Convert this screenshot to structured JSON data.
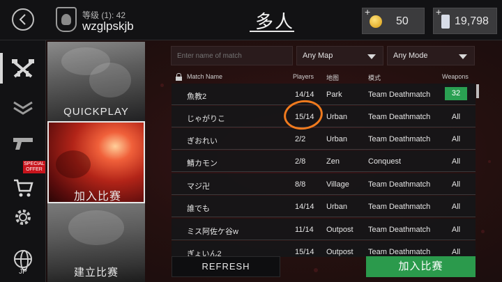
{
  "header": {
    "level_text": "等级 (1): 42",
    "username": "wzglpskjb",
    "title": "多人",
    "gold_value": "50",
    "cash_value": "19,798",
    "plus": "+"
  },
  "sidebar": {
    "special_offer": "SPECIAL OFFER",
    "language": "JP",
    "items": [
      "multiplayer-icon",
      "ranks-icon",
      "weapons-icon",
      "shop-icon",
      "settings-icon",
      "globe-icon"
    ]
  },
  "modes": {
    "quickplay": "QUICKPLAY",
    "join": "加入比赛",
    "create": "建立比赛"
  },
  "filters": {
    "search_placeholder": "Enter name of match",
    "map_value": "Any Map",
    "mode_value": "Any Mode"
  },
  "table": {
    "headers": {
      "name": "Match Name",
      "players": "Players",
      "map": "地图",
      "mode": "模式",
      "weapons": "Weapons"
    },
    "rows": [
      {
        "name": "魚教2",
        "players": "14/14",
        "map": "Park",
        "mode": "Team Deathmatch",
        "weapons": "32"
      },
      {
        "name": "じゃがりこ",
        "players": "15/14",
        "map": "Urban",
        "mode": "Team Deathmatch",
        "weapons": "All"
      },
      {
        "name": "ぎおれい",
        "players": "2/2",
        "map": "Urban",
        "mode": "Team Deathmatch",
        "weapons": "All"
      },
      {
        "name": "鯖カモン",
        "players": "2/8",
        "map": "Zen",
        "mode": "Conquest",
        "weapons": "All"
      },
      {
        "name": "マジ卍",
        "players": "8/8",
        "map": "Village",
        "mode": "Team Deathmatch",
        "weapons": "All"
      },
      {
        "name": "誰でも",
        "players": "14/14",
        "map": "Urban",
        "mode": "Team Deathmatch",
        "weapons": "All"
      },
      {
        "name": "ミス阿佐ケ谷w",
        "players": "11/14",
        "map": "Outpost",
        "mode": "Team Deathmatch",
        "weapons": "All"
      },
      {
        "name": "ぎょいん2",
        "players": "15/14",
        "map": "Outpost",
        "mode": "Team Deathmatch",
        "weapons": "All"
      }
    ]
  },
  "buttons": {
    "refresh": "REFRESH",
    "join": "加入比赛"
  },
  "colors": {
    "accent_green": "#2b9a4c",
    "annotation_orange": "#f07a1e",
    "special_red": "#c8141c"
  }
}
